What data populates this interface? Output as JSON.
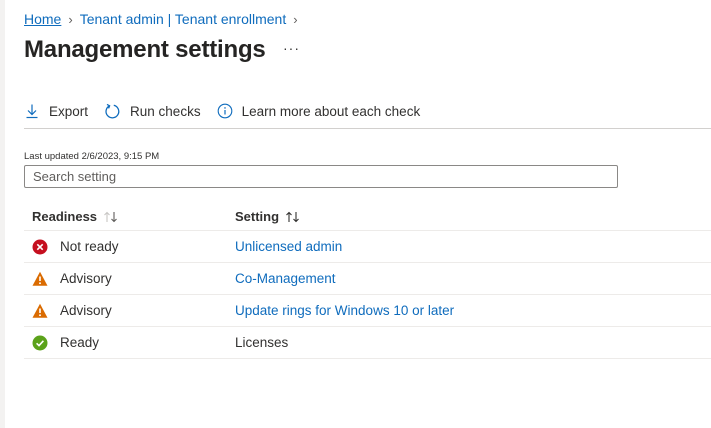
{
  "breadcrumb": {
    "items": [
      "Home",
      "Tenant admin | Tenant enrollment"
    ]
  },
  "page": {
    "title": "Management settings",
    "more_label": "···"
  },
  "toolbar": {
    "export_label": "Export",
    "run_checks_label": "Run checks",
    "learn_more_label": "Learn more about each check"
  },
  "last_updated": "Last updated 2/6/2023, 9:15 PM",
  "search": {
    "placeholder": "Search setting",
    "value": ""
  },
  "table": {
    "columns": [
      "Readiness",
      "Setting"
    ],
    "rows": [
      {
        "readiness": "Not ready",
        "status_icon": "error-circle-icon",
        "setting": "Unlicensed admin",
        "is_link": true
      },
      {
        "readiness": "Advisory",
        "status_icon": "warning-triangle-icon",
        "setting": "Co-Management",
        "is_link": true
      },
      {
        "readiness": "Advisory",
        "status_icon": "warning-triangle-icon",
        "setting": "Update rings for Windows 10 or later",
        "is_link": true
      },
      {
        "readiness": "Ready",
        "status_icon": "checkmark-circle-icon",
        "setting": "Licenses",
        "is_link": false
      }
    ]
  },
  "colors": {
    "link": "#0f6cbd",
    "error": "#c50f1f",
    "warning": "#da6b01",
    "success": "#5ba21a"
  }
}
